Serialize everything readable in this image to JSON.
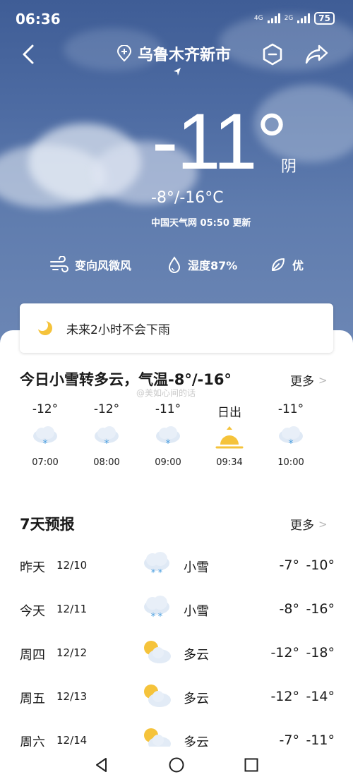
{
  "status_bar": {
    "time": "06:36",
    "network1": "4G",
    "network2": "2G",
    "battery": "75"
  },
  "header": {
    "city": "乌鲁木齐新市"
  },
  "current": {
    "temperature": "-11°",
    "condition": "阴",
    "range": "-8°/-16°C",
    "update": "中国天气网 05:50 更新"
  },
  "metrics": {
    "wind": "变向风微风",
    "humidity": "湿度87%",
    "air": "优"
  },
  "rain_notice": "未来2小时不会下雨",
  "today": {
    "title": "今日小雪转多云，气温-8°/-16°",
    "more": "更多",
    "watermark": "@美如心间的话",
    "hourly": [
      {
        "temp": "-12°",
        "icon": "snow-cloud-icon",
        "time": "07:00"
      },
      {
        "temp": "-12°",
        "icon": "snow-cloud-icon",
        "time": "08:00"
      },
      {
        "temp": "-11°",
        "icon": "snow-cloud-icon",
        "time": "09:00"
      },
      {
        "temp": "日出",
        "icon": "sunrise-icon",
        "time": "09:34"
      },
      {
        "temp": "-11°",
        "icon": "snow-cloud-icon",
        "time": "10:00"
      }
    ]
  },
  "week": {
    "title": "7天预报",
    "more": "更多",
    "days": [
      {
        "day": "昨天",
        "date": "12/10",
        "icon": "snow-icon",
        "desc": "小雪",
        "hi": "-7°",
        "lo": "-10°"
      },
      {
        "day": "今天",
        "date": "12/11",
        "icon": "snow-icon",
        "desc": "小雪",
        "hi": "-8°",
        "lo": "-16°"
      },
      {
        "day": "周四",
        "date": "12/12",
        "icon": "partly-cloudy-icon",
        "desc": "多云",
        "hi": "-12°",
        "lo": "-18°"
      },
      {
        "day": "周五",
        "date": "12/13",
        "icon": "partly-cloudy-icon",
        "desc": "多云",
        "hi": "-12°",
        "lo": "-14°"
      },
      {
        "day": "周六",
        "date": "12/14",
        "icon": "partly-cloudy-icon",
        "desc": "多云",
        "hi": "-7°",
        "lo": "-11°"
      }
    ]
  },
  "colors": {
    "sky_top": "#3f5d96",
    "sky_bottom": "#6f89b6",
    "sun": "#f5c33b",
    "snow_blue": "#4a9fe0"
  }
}
